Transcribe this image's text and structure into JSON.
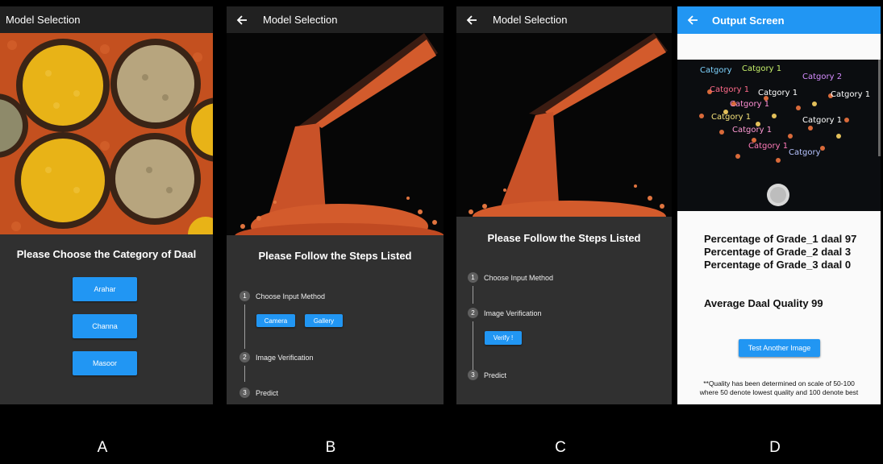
{
  "panel_a": {
    "title": "Model Selection",
    "heading": "Please Choose the Category of Daal",
    "buttons": [
      "Arahar",
      "Channa",
      "Masoor"
    ],
    "label": "A"
  },
  "panel_b": {
    "title": "Model Selection",
    "heading": "Please Follow the Steps Listed",
    "steps": [
      {
        "num": "1",
        "label": "Choose Input Method"
      },
      {
        "num": "2",
        "label": "Image Verification"
      },
      {
        "num": "3",
        "label": "Predict"
      }
    ],
    "camera_label": "Camera",
    "gallery_label": "Gallery",
    "label": "B"
  },
  "panel_c": {
    "title": "Model Selection",
    "heading": "Please Follow the Steps Listed",
    "steps": [
      {
        "num": "1",
        "label": "Choose Input Method"
      },
      {
        "num": "2",
        "label": "Image Verification"
      },
      {
        "num": "3",
        "label": "Predict"
      }
    ],
    "verify_label": "Verify !",
    "label": "C"
  },
  "panel_d": {
    "title": "Output Screen",
    "grade1": "Percentage of Grade_1 daal 97",
    "grade2": "Percentage of Grade_2 daal 3",
    "grade3": "Percentage of Grade_3 daal 0",
    "average": "Average Daal Quality 99",
    "test_button": "Test Another Image",
    "note_line1": "**Quality has been determined on scale of 50-100",
    "note_line2": "where 50 denote lowest quality and 100 denote best",
    "detection_labels": [
      "Catgory",
      "Catgory 1",
      "Catgory 2",
      "Catgory 1",
      "Catgory 1",
      "Catgory 1",
      "Catgory 1",
      "Catgory 1",
      "Catgory 1",
      "Catgory 1",
      "Catgory 1",
      "Catgory"
    ],
    "label": "D"
  },
  "colors": {
    "accent": "#2196f3",
    "appbar_dark": "#212121",
    "body_dark": "#303030",
    "lentil_red": "#d9592b",
    "lentil_yellow": "#e8b317"
  },
  "icons": {
    "back": "arrow-left-icon"
  }
}
